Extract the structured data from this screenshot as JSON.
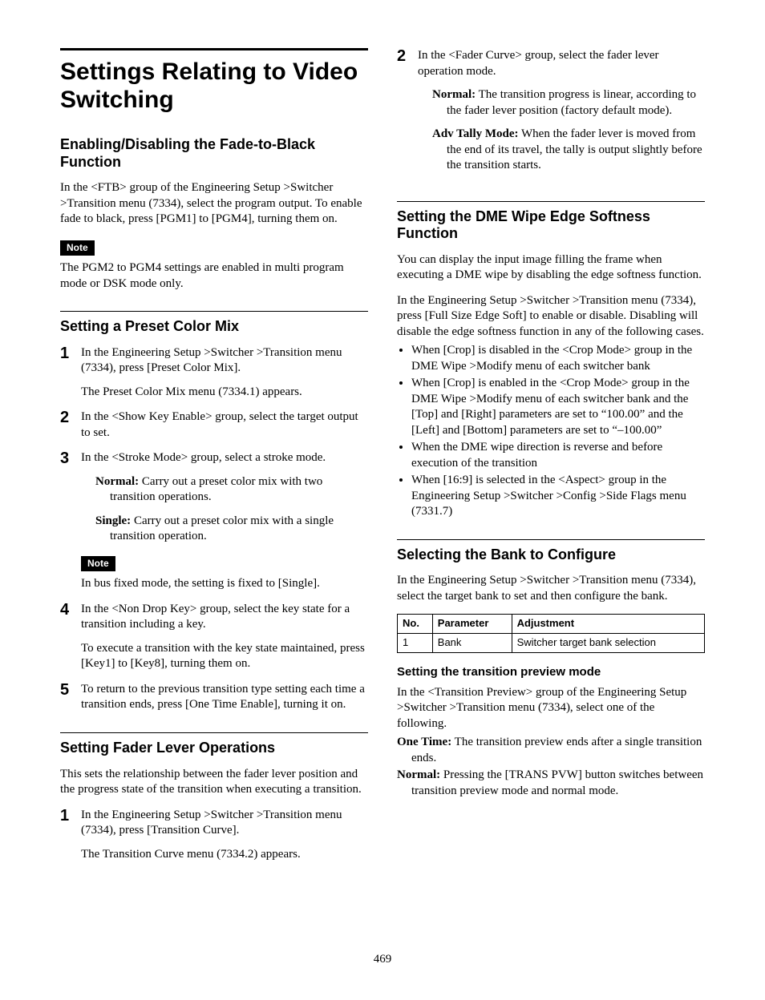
{
  "page_number": "469",
  "title": "Settings Relating to Video Switching",
  "note_label": "Note",
  "sec_ftb": {
    "heading": "Enabling/Disabling the Fade-to-Black Function",
    "p1": "In the <FTB> group of the Engineering Setup >Switcher >Transition menu (7334), select the program output. To enable fade to black, press [PGM1] to [PGM4], turning them on.",
    "note": "The PGM2 to PGM4 settings are enabled in multi program mode or DSK mode only."
  },
  "sec_pcm": {
    "heading": "Setting a Preset Color Mix",
    "s1a": "In the Engineering Setup >Switcher >Transition menu (7334), press [Preset Color Mix].",
    "s1b": "The Preset Color Mix menu (7334.1) appears.",
    "s2": "In the <Show Key Enable> group, select the target output to set.",
    "s3": "In the <Stroke Mode> group, select a stroke mode.",
    "s3_normal_t": "Normal:",
    "s3_normal_d": " Carry out a preset color mix with two transition operations.",
    "s3_single_t": "Single:",
    "s3_single_d": " Carry out a preset color mix with a single transition operation.",
    "s3_note": "In bus fixed mode, the setting is fixed to [Single].",
    "s4a": "In the <Non Drop Key> group, select the key state for a transition including a key.",
    "s4b": "To execute a transition with the key state maintained, press [Key1] to [Key8], turning them on.",
    "s5": "To return to the previous transition type setting each time a transition ends, press [One Time Enable], turning it on."
  },
  "sec_fader": {
    "heading": "Setting Fader Lever Operations",
    "p1": "This sets the relationship between the fader lever position and the progress state of the transition when executing a transition.",
    "s1a": "In the Engineering Setup >Switcher >Transition menu (7334), press [Transition Curve].",
    "s1b": "The Transition Curve menu (7334.2) appears.",
    "s2": "In the <Fader Curve> group, select the fader lever operation mode.",
    "s2_normal_t": "Normal:",
    "s2_normal_d": " The transition progress is linear, according to the fader lever position (factory default mode).",
    "s2_adv_t": "Adv Tally Mode:",
    "s2_adv_d": " When the fader lever is moved from the end of its travel, the tally is output slightly before the transition starts."
  },
  "sec_dme": {
    "heading": "Setting the DME Wipe Edge Softness Function",
    "p1": "You can display the input image filling the frame when executing a DME wipe by disabling the edge softness function.",
    "p2": "In the Engineering Setup >Switcher >Transition menu (7334), press [Full Size Edge Soft] to enable or disable. Disabling will disable the edge softness function in any of the following cases.",
    "b1": "When [Crop] is disabled in the <Crop Mode> group in the DME Wipe >Modify menu of each switcher bank",
    "b2": "When [Crop] is enabled in the <Crop Mode> group in the DME Wipe >Modify menu of each switcher bank and the [Top] and [Right] parameters are set to “100.00” and the [Left] and [Bottom] parameters are set to “–100.00”",
    "b3": "When the DME wipe direction is reverse and before execution of the transition",
    "b4": "When [16:9] is selected in the <Aspect> group in the Engineering Setup >Switcher >Config >Side Flags menu (7331.7)"
  },
  "sec_bank": {
    "heading": "Selecting the Bank to Configure",
    "p1": "In the Engineering Setup >Switcher >Transition menu (7334), select the target bank to set and then configure the bank.",
    "th_no": "No.",
    "th_param": "Parameter",
    "th_adj": "Adjustment",
    "r1_no": "1",
    "r1_param": "Bank",
    "r1_adj": "Switcher target bank selection",
    "sub_heading": "Setting the transition preview mode",
    "sub_p1": "In the <Transition Preview> group of the Engineering Setup >Switcher >Transition menu (7334), select one of the following.",
    "d1_t": "One Time:",
    "d1_d": " The transition preview ends after a single transition ends.",
    "d2_t": "Normal:",
    "d2_d": " Pressing the [TRANS PVW] button switches between transition preview mode and normal mode."
  }
}
